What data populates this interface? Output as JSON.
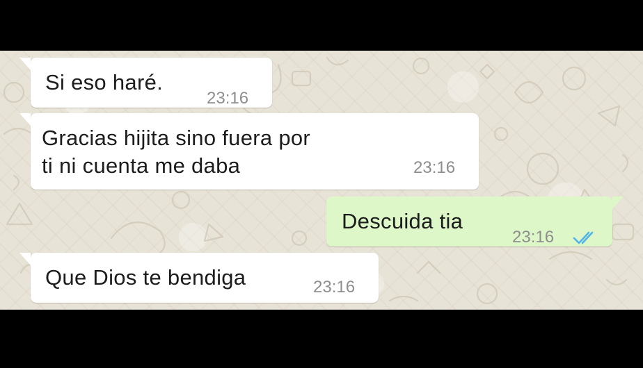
{
  "conversation": {
    "messages": [
      {
        "direction": "incoming",
        "text": "Si eso haré.",
        "time": "23:16"
      },
      {
        "direction": "incoming",
        "text": "Gracias hijita sino fuera por\nti ni cuenta me daba",
        "time": "23:16"
      },
      {
        "direction": "outgoing",
        "text": "Descuida tia",
        "time": "23:16",
        "status": "read",
        "status_icon": "double-check-icon",
        "status_color": "#4fb3e8"
      },
      {
        "direction": "incoming",
        "text": "Que Dios te bendiga",
        "time": "23:16"
      }
    ]
  },
  "theme": {
    "incoming_bubble": "#ffffff",
    "outgoing_bubble": "#ddf7c8",
    "wallpaper": "#e8e3d7"
  }
}
